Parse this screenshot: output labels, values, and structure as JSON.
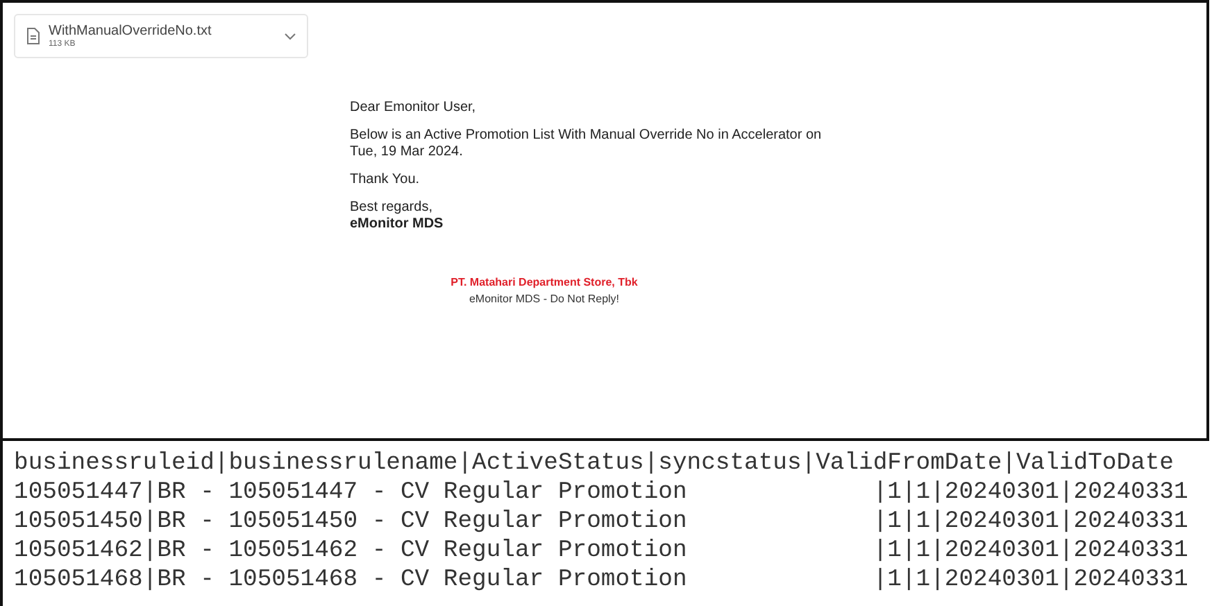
{
  "attachment": {
    "file_name": "WithManualOverrideNo.txt",
    "file_size": "113 KB"
  },
  "email": {
    "greeting": "Dear Emonitor User,",
    "body_line_1": "Below is an Active Promotion List With Manual Override No in Accelerator on",
    "body_line_2": "Tue, 19 Mar 2024.",
    "thanks": "Thank You.",
    "closing": "Best regards,",
    "sender": "eMonitor MDS",
    "footer_company": "PT. Matahari Department Store, Tbk",
    "footer_note": "eMonitor MDS - Do Not Reply!"
  },
  "text_file": {
    "lines": [
      "businessruleid|businessrulename|ActiveStatus|syncstatus|ValidFromDate|ValidToDate",
      "105051447|BR - 105051447 - CV Regular Promotion             |1|1|20240301|20240331",
      "105051450|BR - 105051450 - CV Regular Promotion             |1|1|20240301|20240331",
      "105051462|BR - 105051462 - CV Regular Promotion             |1|1|20240301|20240331",
      "105051468|BR - 105051468 - CV Regular Promotion             |1|1|20240301|20240331"
    ]
  }
}
